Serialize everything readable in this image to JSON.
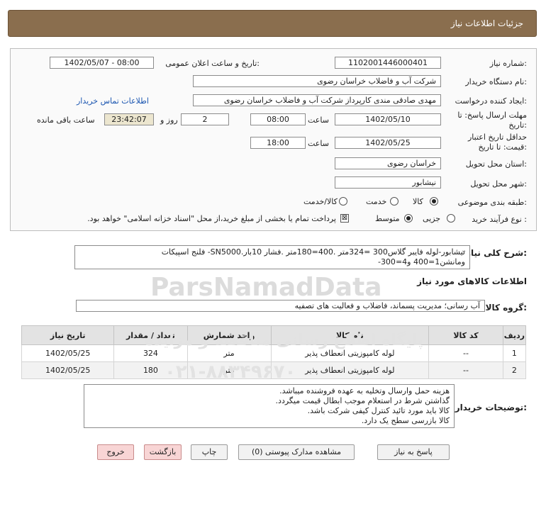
{
  "header": {
    "title": "جزئیات اطلاعات نیاز"
  },
  "form": {
    "need_number_label": "شماره نیاز:",
    "need_number": "1102001446000401",
    "announce_label": "تاریخ و ساعت اعلان عمومی:",
    "announce_value": "1402/05/07 - 08:00",
    "buyer_label": "نام دستگاه خریدار:",
    "buyer": "شرکت آب و فاضلاب خراسان رضوی",
    "creator_label": "ایجاد کننده درخواست:",
    "creator": "مهدی صادقی مندی کارپرداز شرکت آب و فاضلاب خراسان رضوی",
    "contact_link": "اطلاعات تماس خریدار",
    "send_deadline_label_1": "مهلت ارسال پاسخ: تا",
    "send_deadline_label_2": "تاریخ:",
    "send_date": "1402/05/10",
    "time_label": "ساعت",
    "send_time": "08:00",
    "days": "2",
    "days_label": "روز و",
    "remaining_time": "23:42:07",
    "remaining_label": "ساعت باقی مانده",
    "validity_label_1": "حداقل تاریخ اعتبار",
    "validity_label_2": "قیمت: تا تاریخ:",
    "validity_date": "1402/05/25",
    "validity_time_label": "ساعت",
    "validity_time": "18:00",
    "province_label": "استان محل تحویل:",
    "province": "خراسان رضوی",
    "city_label": "شهر محل تحویل:",
    "city": "نیشابور",
    "category_label": "طبقه بندی موضوعی:",
    "category_options": [
      "کالا",
      "خدمت",
      "کالا/خدمت"
    ],
    "category_selected": "کالا",
    "process_label": "نوع فرآیند خرید :",
    "process_options": [
      "جزیی",
      "متوسط"
    ],
    "process_selected": "متوسط",
    "payment_note": "پرداخت تمام یا بخشی از مبلغ خرید،از محل \"اسناد خزانه اسلامی\" خواهد بود."
  },
  "description": {
    "label": "شرح کلی نیاز:",
    "line1": "نیشابور-لوله فایبر گلاس300 =324متر .400=180متر .فشار 10بار.SN5000- فلنج اسپیکات",
    "line2": "ومانشن1=400 و4=300-"
  },
  "goods": {
    "section_title": "اطلاعات کالاهای مورد نیاز",
    "group_label": "گروه کالا:",
    "group_value": "آب رسانی؛ مدیریت پسماند، فاضلاب و فعالیت های تصفیه",
    "columns": [
      "ردیف",
      "کد کالا",
      "نام کالا",
      "واحد شمارش",
      "تعداد / مقدار",
      "تاریخ نیاز"
    ],
    "rows": [
      {
        "row": "1",
        "code": "--",
        "name": "لوله کامپوزیتی انعطاف پذیر",
        "unit": "متر",
        "qty": "324",
        "date": "1402/05/25"
      },
      {
        "row": "2",
        "code": "--",
        "name": "لوله کامپوزیتی انعطاف پذیر",
        "unit": "متر",
        "qty": "180",
        "date": "1402/05/25"
      }
    ]
  },
  "notes": {
    "label": "توضیحات خریدار:",
    "lines": [
      "هزینه حمل وارسال وتخلیه به عهده فروشنده میباشد.",
      "گذاشتن شرط در استعلام موجب ابطال قیمت میگردد.",
      "کالا باید مورد تائید کنترل کیفی شرکت باشد.",
      "کالا بازرسی سطح یک دارد."
    ]
  },
  "buttons": {
    "reply": "پاسخ به نیاز",
    "attachments": "مشاهده مدارک پیوستی (0)",
    "print": "چاپ",
    "back": "بازگشت",
    "exit": "خروج"
  },
  "watermark": {
    "brand": "ParsNamadData",
    "subtitle": "پایگاه اطلاع رسانی مناقصه و مزایده",
    "phone": "۰۲۱-۸۸۳۴۹۶۷۰"
  }
}
